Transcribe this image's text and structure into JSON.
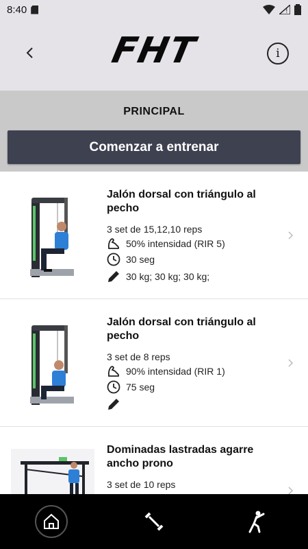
{
  "status_bar": {
    "time": "8:40"
  },
  "header": {
    "logo_text": "FHT"
  },
  "section": {
    "title": "PRINCIPAL",
    "start_button_label": "Comenzar a entrenar"
  },
  "exercises": [
    {
      "title": "Jalón dorsal con triángulo al pecho",
      "sets": "3 set de 15,12,10 reps",
      "intensity": "50% intensidad (RIR 5)",
      "rest": "30 seg",
      "notes": "30 kg; 30 kg; 30 kg;"
    },
    {
      "title": "Jalón dorsal con triángulo al pecho",
      "sets": "3 set de 8 reps",
      "intensity": "90% intensidad (RIR 1)",
      "rest": "75 seg",
      "notes": ""
    },
    {
      "title": "Dominadas lastradas agarre ancho prono",
      "sets": "3 set de 10 reps"
    }
  ],
  "icons": {
    "back": "chevron-left-icon",
    "info": "info-icon",
    "intensity": "flexed-arm-icon",
    "rest": "clock-icon",
    "notes": "pencil-icon",
    "home": "home-icon",
    "workout": "dumbbell-icon",
    "stretch": "stretching-icon"
  },
  "colors": {
    "header_bg": "#e6e3e8",
    "section_bg": "#c9c9c9",
    "button_bg": "#3e4150",
    "nav_bg": "#000000"
  }
}
